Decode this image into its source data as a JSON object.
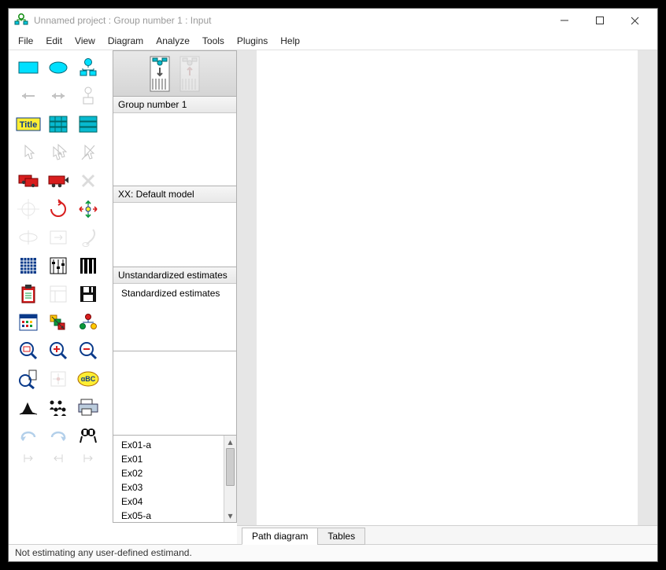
{
  "window": {
    "title": "Unnamed project : Group number 1 : Input"
  },
  "menu": {
    "file": "File",
    "edit": "Edit",
    "view": "View",
    "diagram": "Diagram",
    "analyze": "Analyze",
    "tools": "Tools",
    "plugins": "Plugins",
    "help": "Help"
  },
  "panels": {
    "group": "Group number 1",
    "model": "XX: Default model",
    "est_unstd": "Unstandardized estimates",
    "est_std": "Standardized estimates"
  },
  "files": [
    "Ex01-a",
    "Ex01",
    "Ex02",
    "Ex03",
    "Ex04",
    "Ex05-a"
  ],
  "tabs": {
    "path": "Path diagram",
    "tables": "Tables"
  },
  "status": "Not estimating any user-defined estimand.",
  "colors": {
    "cyan": "#00e0ff",
    "yellow": "#ffee33",
    "red": "#d81e1e",
    "orange": "#ff8a00"
  }
}
